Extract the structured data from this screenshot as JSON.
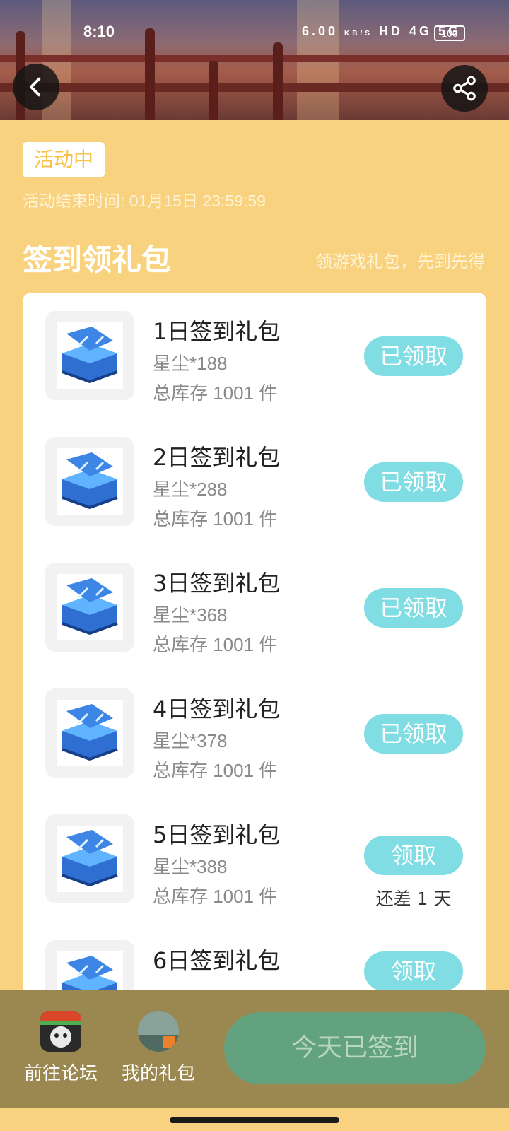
{
  "status_bar": {
    "time": "8:10",
    "net_speed": "6.00",
    "net_speed_unit": "KB/S",
    "hd_label": "HD",
    "signal_4g": "4G",
    "signal_5g": "5G",
    "battery": "100"
  },
  "activity": {
    "badge": "活动中",
    "end_time": "活动结束时间: 01月15日 23:59:59"
  },
  "section": {
    "title": "签到领礼包",
    "subtitle": "领游戏礼包，先到先得"
  },
  "gifts": [
    {
      "name": "1日签到礼包",
      "reward": "星尘*188",
      "stock": "总库存 1001 件",
      "button": "已领取",
      "note": ""
    },
    {
      "name": "2日签到礼包",
      "reward": "星尘*288",
      "stock": "总库存 1001 件",
      "button": "已领取",
      "note": ""
    },
    {
      "name": "3日签到礼包",
      "reward": "星尘*368",
      "stock": "总库存 1001 件",
      "button": "已领取",
      "note": ""
    },
    {
      "name": "4日签到礼包",
      "reward": "星尘*378",
      "stock": "总库存 1001 件",
      "button": "已领取",
      "note": ""
    },
    {
      "name": "5日签到礼包",
      "reward": "星尘*388",
      "stock": "总库存 1001 件",
      "button": "领取",
      "note": "还差 1 天"
    },
    {
      "name": "6日签到礼包",
      "reward": "",
      "stock": "",
      "button": "领取",
      "note": ""
    }
  ],
  "bottom": {
    "forum_label": "前往论坛",
    "my_gifts_label": "我的礼包",
    "signin_button": "今天已签到"
  },
  "colors": {
    "page_bg": "#f8d27f",
    "claim_button": "#7fdde3",
    "bottom_bar": "#9a8850",
    "signin_button": "#62a27e"
  },
  "icons": {
    "back": "chevron-left-icon",
    "share": "share-icon",
    "gift": "blue-treasure-chest-icon"
  }
}
